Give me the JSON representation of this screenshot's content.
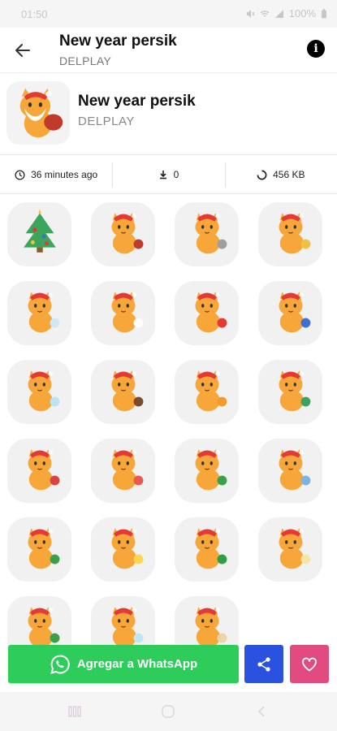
{
  "status_bar": {
    "time": "01:50",
    "battery": "100%"
  },
  "app_bar": {
    "title": "New year persik",
    "subtitle": "DELPLAY",
    "back_icon": "arrow-left-icon",
    "info_icon": "info-icon",
    "info_glyph": "i"
  },
  "pack": {
    "title": "New year persik",
    "author": "DELPLAY"
  },
  "stats": {
    "updated": "36 minutes ago",
    "downloads": "0",
    "size": "456 KB"
  },
  "stickers": [
    {
      "id": "christmas-tree"
    },
    {
      "id": "santa-cat-bag"
    },
    {
      "id": "cat-with-friend"
    },
    {
      "id": "cat-sitting-snacks"
    },
    {
      "id": "cat-snow"
    },
    {
      "id": "cat-snowball"
    },
    {
      "id": "cat-santa-beard"
    },
    {
      "id": "cat-headphones"
    },
    {
      "id": "snowman-cat"
    },
    {
      "id": "cat-bear-costume"
    },
    {
      "id": "cat-orange-hat"
    },
    {
      "id": "cat-gift"
    },
    {
      "id": "cat-lying-gifts"
    },
    {
      "id": "cat-sweets"
    },
    {
      "id": "cat-green-sweater"
    },
    {
      "id": "cat-racket"
    },
    {
      "id": "cat-reading-book"
    },
    {
      "id": "cat-sparkler"
    },
    {
      "id": "cat-holly"
    },
    {
      "id": "cat-champagne"
    },
    {
      "id": "cat-green-gift"
    },
    {
      "id": "cat-snowflake"
    },
    {
      "id": "cat-cookie"
    }
  ],
  "actions": {
    "whatsapp_label": "Agregar a WhatsApp",
    "share_icon": "share-icon",
    "favorite_icon": "heart-icon"
  },
  "colors": {
    "whatsapp_green": "#2ecc5b",
    "share_blue": "#2b52de",
    "favorite_pink": "#e24b7f",
    "cat_orange": "#f7a73a"
  }
}
